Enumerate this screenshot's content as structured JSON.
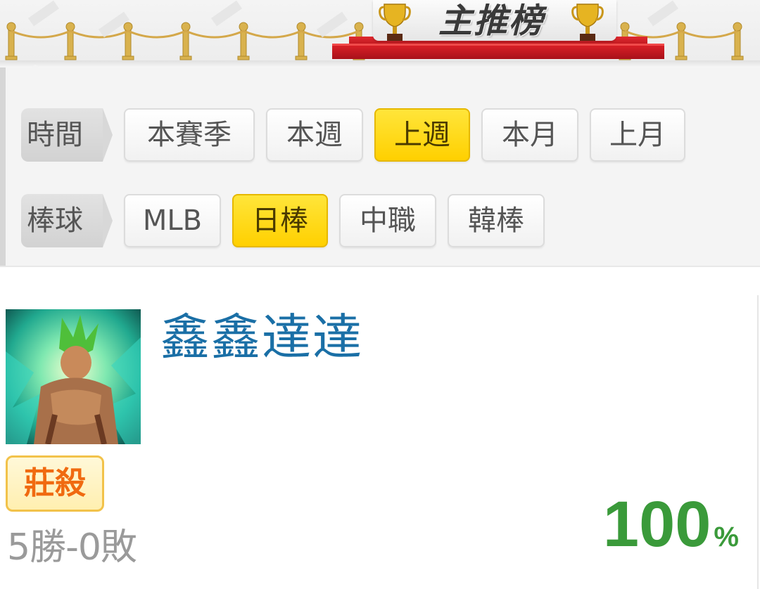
{
  "banner": {
    "title": "主推榜",
    "icons": [
      "trophy-icon",
      "trophy-icon"
    ],
    "colors": {
      "carpet": "#c8141c",
      "rope": "#d4a84a"
    }
  },
  "filters": {
    "time": {
      "label": "時間",
      "options": [
        "本賽季",
        "本週",
        "上週",
        "本月",
        "上月"
      ],
      "selected": "上週"
    },
    "sport": {
      "label": "棒球",
      "options": [
        "MLB",
        "日棒",
        "中職",
        "韓棒"
      ],
      "selected": "日棒"
    }
  },
  "ranking": [
    {
      "name": "鑫鑫達達",
      "tag": "莊殺",
      "record": "5勝-0敗",
      "win_rate": "100",
      "win_rate_unit": "%"
    }
  ],
  "colors": {
    "active_chip": "#ffd400",
    "name": "#1a6fa6",
    "win_rate": "#3a9a3a",
    "tag_text": "#f06a10"
  }
}
